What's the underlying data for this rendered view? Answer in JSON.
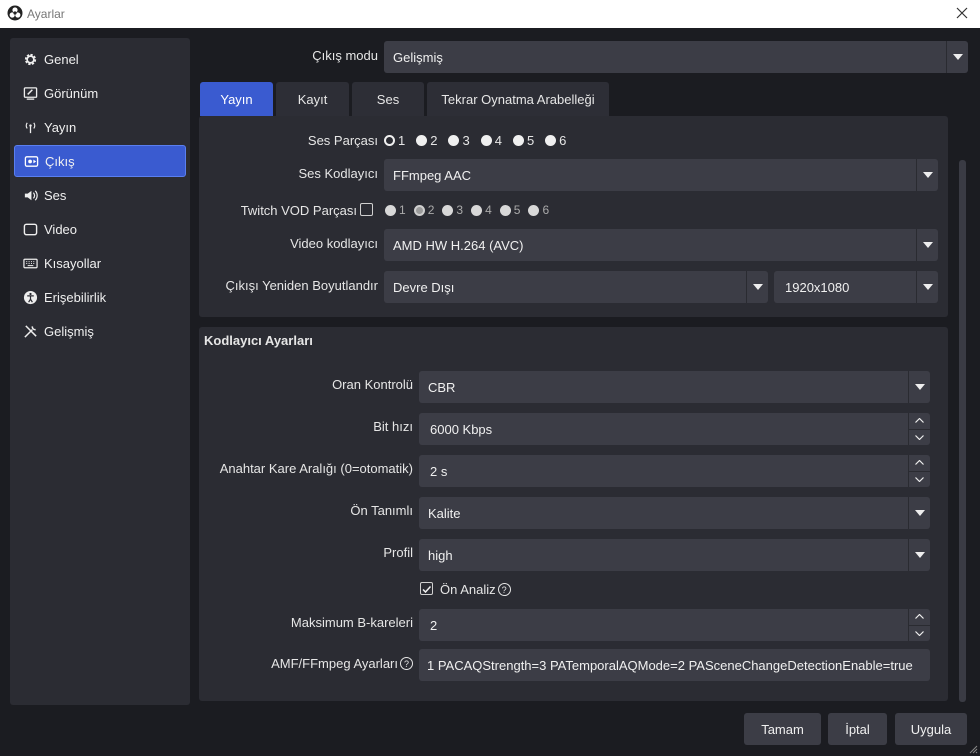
{
  "window": {
    "title": "Ayarlar"
  },
  "sidebar": {
    "items": [
      {
        "label": "Genel",
        "icon": "gear-icon"
      },
      {
        "label": "Görünüm",
        "icon": "appearance-icon"
      },
      {
        "label": "Yayın",
        "icon": "antenna-icon"
      },
      {
        "label": "Çıkış",
        "icon": "output-icon"
      },
      {
        "label": "Ses",
        "icon": "speaker-icon"
      },
      {
        "label": "Video",
        "icon": "monitor-icon"
      },
      {
        "label": "Kısayollar",
        "icon": "keyboard-icon"
      },
      {
        "label": "Erişebilirlik",
        "icon": "accessibility-icon"
      },
      {
        "label": "Gelişmiş",
        "icon": "tools-icon"
      }
    ],
    "active_index": 3
  },
  "output_mode": {
    "label": "Çıkış modu",
    "value": "Gelişmiş"
  },
  "tabs": [
    "Yayın",
    "Kayıt",
    "Ses",
    "Tekrar Oynatma Arabelleği"
  ],
  "active_tab": 0,
  "stream": {
    "audio_track_label": "Ses Parçası",
    "audio_tracks": [
      "1",
      "2",
      "3",
      "4",
      "5",
      "6"
    ],
    "audio_track_selected": "1",
    "audio_encoder_label": "Ses Kodlayıcı",
    "audio_encoder_value": "FFmpeg AAC",
    "twitch_vod_label": "Twitch VOD Parçası",
    "twitch_vod_tracks": [
      "1",
      "2",
      "3",
      "4",
      "5",
      "6"
    ],
    "twitch_vod_selected": "2",
    "video_encoder_label": "Video kodlayıcı",
    "video_encoder_value": "AMD HW H.264 (AVC)",
    "rescale_label": "Çıkışı Yeniden Boyutlandır",
    "rescale_value": "Devre Dışı",
    "rescale_resolution": "1920x1080"
  },
  "encoder_settings": {
    "section_title": "Kodlayıcı Ayarları",
    "rate_control_label": "Oran Kontrolü",
    "rate_control_value": "CBR",
    "bitrate_label": "Bit hızı",
    "bitrate_value": "6000 Kbps",
    "keyframe_label": "Anahtar Kare Aralığı (0=otomatik)",
    "keyframe_value": "2 s",
    "preset_label": "Ön Tanımlı",
    "preset_value": "Kalite",
    "profile_label": "Profil",
    "profile_value": "high",
    "preanalysis_label": "Ön Analiz",
    "preanalysis_checked": true,
    "max_bframes_label": "Maksimum B-kareleri",
    "max_bframes_value": "2",
    "amf_label": "AMF/FFmpeg Ayarları",
    "amf_value": "1 PACAQStrength=3 PATemporalAQMode=2 PASceneChangeDetectionEnable=true"
  },
  "buttons": {
    "ok": "Tamam",
    "cancel": "İptal",
    "apply": "Uygula"
  },
  "colors": {
    "accent": "#3a5bd0",
    "background": "#1b1c21",
    "panel": "#2b2c33",
    "field": "#3c3d46"
  }
}
